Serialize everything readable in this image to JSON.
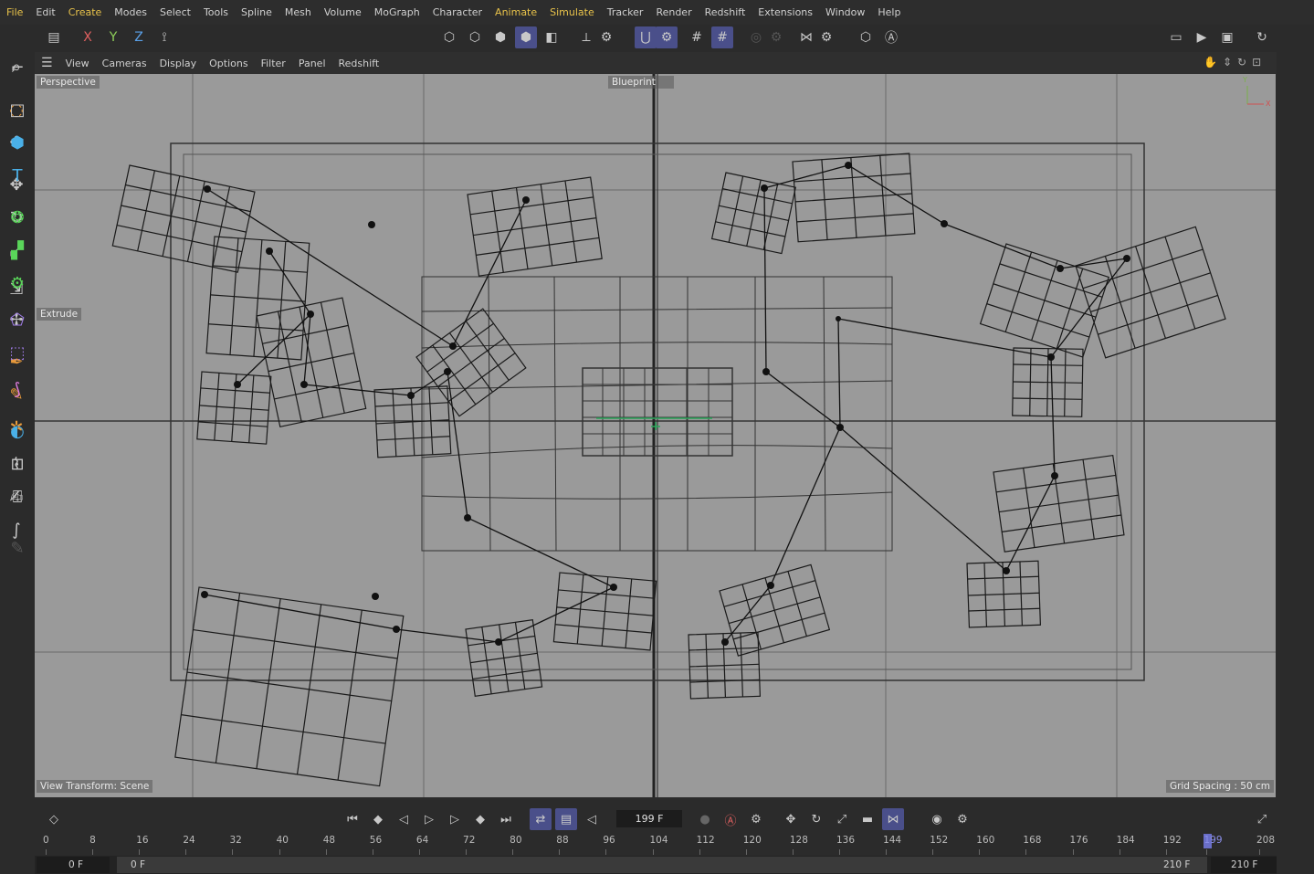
{
  "menubar": {
    "items": [
      {
        "label": "File",
        "hl": true
      },
      {
        "label": "Edit",
        "hl": false
      },
      {
        "label": "Create",
        "hl": true
      },
      {
        "label": "Modes",
        "hl": false
      },
      {
        "label": "Select",
        "hl": false
      },
      {
        "label": "Tools",
        "hl": false
      },
      {
        "label": "Spline",
        "hl": false
      },
      {
        "label": "Mesh",
        "hl": false
      },
      {
        "label": "Volume",
        "hl": false
      },
      {
        "label": "MoGraph",
        "hl": false
      },
      {
        "label": "Character",
        "hl": false
      },
      {
        "label": "Animate",
        "hl": true
      },
      {
        "label": "Simulate",
        "hl": true
      },
      {
        "label": "Tracker",
        "hl": false
      },
      {
        "label": "Render",
        "hl": false
      },
      {
        "label": "Redshift",
        "hl": false
      },
      {
        "label": "Extensions",
        "hl": false
      },
      {
        "label": "Window",
        "hl": false
      },
      {
        "label": "Help",
        "hl": false
      }
    ]
  },
  "axis_buttons": {
    "x": "X",
    "y": "Y",
    "z": "Z"
  },
  "viewport_menu": [
    "View",
    "Cameras",
    "Display",
    "Options",
    "Filter",
    "Panel",
    "Redshift"
  ],
  "viewport": {
    "camera_label": "Perspective",
    "mode_label": "Blueprint",
    "object_label": "Extrude",
    "view_transform": "View Transform: Scene",
    "grid_spacing": "Grid Spacing : 50 cm",
    "axis_gizmo": {
      "y": "Y",
      "x": "X"
    }
  },
  "timeline": {
    "current_frame": "199 F",
    "ticks": [
      "0",
      "8",
      "16",
      "24",
      "32",
      "40",
      "48",
      "56",
      "64",
      "72",
      "80",
      "88",
      "96",
      "104",
      "112",
      "120",
      "128",
      "136",
      "144",
      "152",
      "160",
      "168",
      "176",
      "184",
      "192",
      "199",
      "208"
    ],
    "playhead": "199",
    "range_start_left": "0 F",
    "range_start_right": "0 F",
    "range_end_left": "210 F",
    "range_end_right": "210 F"
  },
  "colors": {
    "accent": "#e8c24a",
    "active_button": "#4a4f8a",
    "viewport_bg": "#9a9a9a",
    "icon_blue": "#4ab0e8"
  }
}
